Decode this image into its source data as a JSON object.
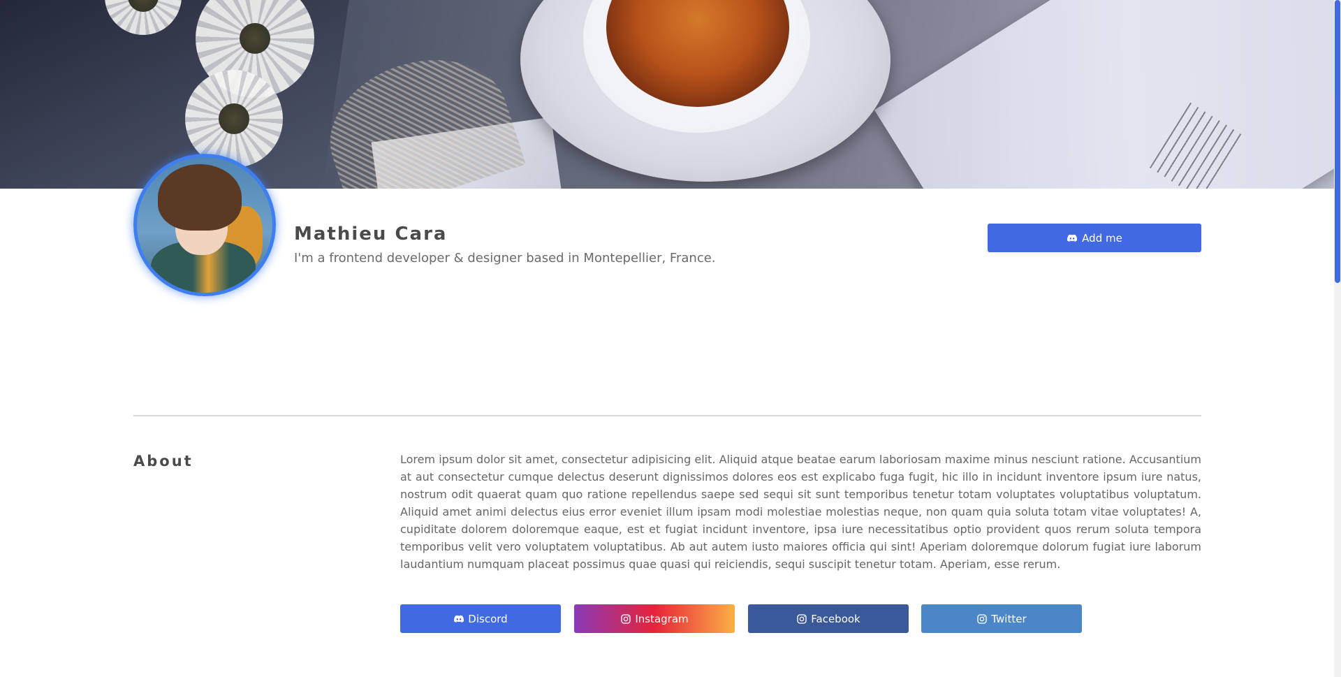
{
  "profile": {
    "name": "Mathieu Cara",
    "tagline": "I'm a frontend developer & designer based in Montepellier, France.",
    "add_button_label": "Add me"
  },
  "about": {
    "title": "About",
    "text": "Lorem ipsum dolor sit amet, consectetur adipisicing elit. Aliquid atque beatae earum laboriosam maxime minus nesciunt ratione. Accusantium at aut consectetur cumque delectus deserunt dignissimos dolores eos est explicabo fuga fugit, hic illo in incidunt inventore ipsum iure natus, nostrum odit quaerat quam quo ratione repellendus saepe sed sequi sit sunt temporibus tenetur totam voluptates voluptatibus voluptatum. Aliquid amet animi delectus eius error eveniet illum ipsam modi molestiae molestias neque, non quam quia soluta totam vitae voluptates! A, cupiditate dolorem doloremque eaque, est et fugiat incidunt inventore, ipsa iure necessitatibus optio provident quos rerum soluta tempora temporibus velit vero voluptatem voluptatibus. Ab aut autem iusto maiores officia qui sint! Aperiam doloremque dolorum fugiat iure laborum laudantium numquam placeat possimus quae quasi qui reiciendis, sequi suscipit tenetur totam. Aperiam, esse rerum."
  },
  "social": [
    {
      "label": "Discord",
      "icon": "discord-icon",
      "color": "#4169e1"
    },
    {
      "label": "Instagram",
      "icon": "instagram-icon",
      "color": "linear-gradient(90deg,#8a3ab9,#e6233a,#fcaf45)"
    },
    {
      "label": "Facebook",
      "icon": "instagram-icon",
      "color": "#3b5998"
    },
    {
      "label": "Twitter",
      "icon": "instagram-icon",
      "color": "#4a86c8"
    }
  ],
  "colors": {
    "accent": "#4169e1",
    "avatar_ring": "#3f7ef0",
    "divider": "#d8d8d8"
  }
}
